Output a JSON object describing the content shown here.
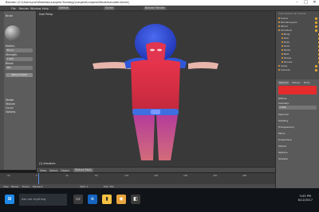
{
  "titlebar": {
    "title": "Blender [C:\\Users\\yrai\\Desktop\\Largest Strategy\\Largest\\Largest\\Models\\model.blend]",
    "minimize": "–",
    "maximize": "□",
    "close": "✕"
  },
  "infobar": {
    "menus": [
      "File",
      "Render",
      "Window",
      "Help"
    ],
    "layout": "Default",
    "scene": "Scene",
    "engine": "Blender Render"
  },
  "leftpanel": {
    "rows": [
      {
        "label": "Brush",
        "value": ""
      },
      {
        "label": "Radius:",
        "value": "50 px"
      },
      {
        "label": "Strength:",
        "value": "1.000"
      },
      {
        "label": "Blend:",
        "value": "Mix"
      },
      {
        "label": "Stroke",
        "value": ""
      },
      {
        "label": "Texture",
        "value": ""
      },
      {
        "label": "Curve",
        "value": ""
      },
      {
        "label": "Options",
        "value": ""
      }
    ],
    "mode": "Texture Paint"
  },
  "viewport": {
    "label": "User Persp",
    "footer": "(1) Armature"
  },
  "vp_header": {
    "items": [
      "View",
      "Select",
      "Object",
      "Texture Paint"
    ]
  },
  "timeline": {
    "ticks": [
      "-40",
      "0",
      "40",
      "80",
      "120",
      "160",
      "200",
      "240",
      "280"
    ],
    "controls": [
      "View",
      "Marker",
      "Frame",
      "Playback"
    ],
    "start": "Start: 1",
    "end": "End: 250"
  },
  "outliner": {
    "header": "View  Search  All Scenes",
    "items": [
      "Scene",
      "RenderLayers",
      "World",
      "Armature",
      "Body",
      "Hair",
      "Eyes",
      "Shirt",
      "Pants",
      "Belt",
      "Shoes",
      "Gloves",
      "Lamp",
      "Camera"
    ]
  },
  "props": {
    "tabs": [
      "Material",
      "Texture",
      "Node"
    ],
    "rows": [
      {
        "label": "Diffuse",
        "value": ""
      },
      {
        "label": "Intensity:",
        "value": "0.800"
      },
      {
        "label": "Specular",
        "value": ""
      },
      {
        "label": "Shading",
        "value": ""
      },
      {
        "label": "Transparency",
        "value": ""
      },
      {
        "label": "Mirror",
        "value": ""
      },
      {
        "label": "Subsurface",
        "value": ""
      },
      {
        "label": "Strand",
        "value": ""
      },
      {
        "label": "Options",
        "value": ""
      },
      {
        "label": "Shadow",
        "value": ""
      }
    ],
    "swatch_color": "#e52b2b"
  },
  "taskbar": {
    "search": "Ask me anything",
    "time": "3:45 PM",
    "date": "6/12/2017"
  },
  "colors": {
    "hair": "#2d49d6",
    "shirt": "#e0303e",
    "pants": "#c13a8e",
    "skin": "#e8b0a8"
  }
}
